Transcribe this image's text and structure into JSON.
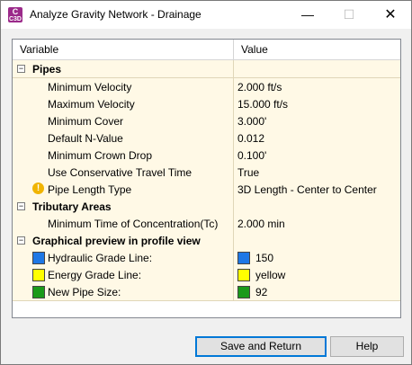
{
  "window": {
    "title": "Analyze Gravity Network - Drainage",
    "icon_text_top": "C",
    "icon_text_bottom": "C3D",
    "min_glyph": "—",
    "max_glyph": "☐",
    "close_glyph": "✕"
  },
  "grid": {
    "columns": [
      "Variable",
      "Value"
    ],
    "pipes_label": "Pipes",
    "pipes_rows": [
      {
        "label": "Minimum Velocity",
        "value": "2.000 ft/s"
      },
      {
        "label": "Maximum Velocity",
        "value": "15.000 ft/s"
      },
      {
        "label": "Minimum Cover",
        "value": "3.000'"
      },
      {
        "label": "Default N-Value",
        "value": "0.012"
      },
      {
        "label": "Minimum Crown Drop",
        "value": "0.100'"
      },
      {
        "label": "Use Conservative Travel Time",
        "value": "True"
      },
      {
        "label": "Pipe Length Type",
        "value": "3D Length - Center to Center"
      }
    ],
    "tributary_label": "Tributary Areas",
    "tributary_rows": [
      {
        "label": "Minimum Time of Concentration(Tc)",
        "value": "2.000 min"
      }
    ],
    "preview_label": "Graphical preview in profile view",
    "preview_rows": [
      {
        "label": "Hydraulic Grade Line:",
        "value": "150",
        "color": "#1e78e6"
      },
      {
        "label": "Energy Grade Line:",
        "value": "yellow",
        "color": "#ffff00"
      },
      {
        "label": "New Pipe Size:",
        "value": "92",
        "color": "#1a9a1a"
      }
    ],
    "toggle_glyph": "−",
    "warn_glyph": "!"
  },
  "buttons": {
    "save": "Save and Return",
    "help": "Help"
  }
}
